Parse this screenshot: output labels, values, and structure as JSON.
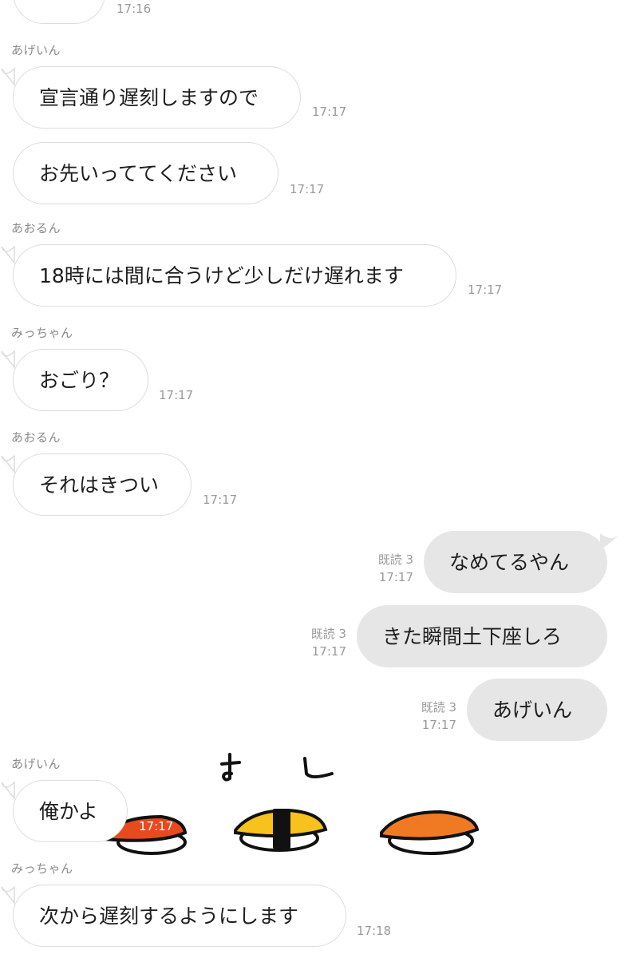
{
  "colors": {
    "incoming_bubble": "#ffffff",
    "outgoing_bubble": "#e6e6e6",
    "meta_text": "#9a9a9a"
  },
  "messages": [
    {
      "time": "17:16"
    },
    {
      "sender": "あげいん",
      "text": "宣言通り遅刻しますので",
      "time": "17:17"
    },
    {
      "text": "お先いっててください",
      "time": "17:17"
    },
    {
      "sender": "あおるん",
      "text": "18時には間に合うけど少しだけ遅れます",
      "time": "17:17"
    },
    {
      "sender": "みっちゃん",
      "text": "おごり？",
      "time": "17:17"
    },
    {
      "sender": "あおるん",
      "text": "それはきつい",
      "time": "17:17"
    },
    {
      "text": "なめてるやん",
      "read": "既読 3",
      "time": "17:17"
    },
    {
      "text": "きた瞬間土下座しろ",
      "read": "既読 3",
      "time": "17:17"
    },
    {
      "text": "あげいん",
      "read": "既読 3",
      "time": "17:17"
    },
    {
      "sender": "あげいん",
      "text": "俺かよ",
      "time": "17:17"
    },
    {
      "sender": "みっちゃん",
      "text": "次から遅刻するようにします",
      "time": "17:18"
    }
  ],
  "sticker": {
    "name": "sushi-sticker",
    "caption": "す し"
  }
}
